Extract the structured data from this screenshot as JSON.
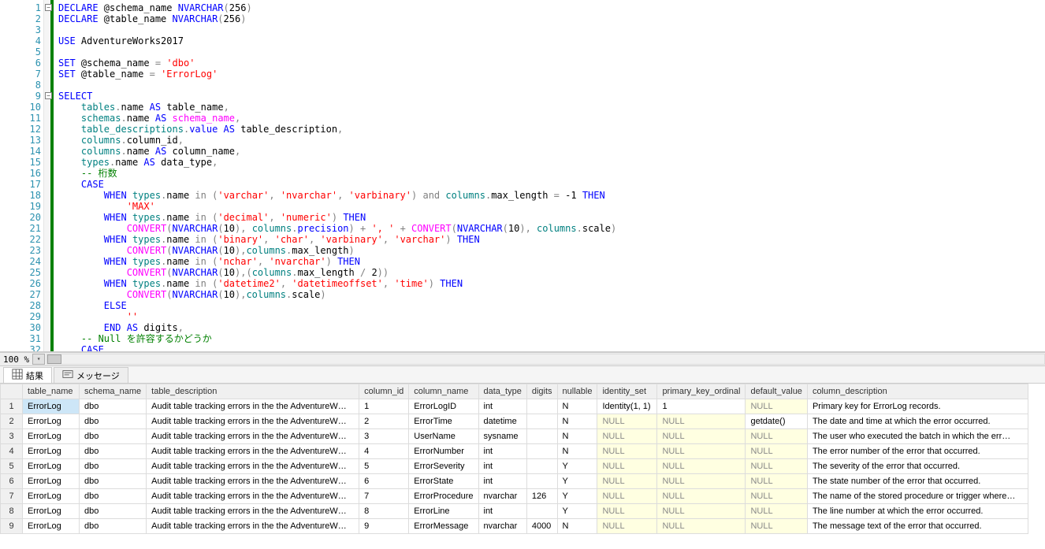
{
  "editor": {
    "lines": 32,
    "fold_markers": [
      {
        "line": 1,
        "sym": "−"
      },
      {
        "line": 9,
        "sym": "−"
      }
    ],
    "tokens": [
      [
        {
          "t": "DECLARE",
          "c": "kw"
        },
        {
          "t": " @schema_name ",
          "c": ""
        },
        {
          "t": "NVARCHAR",
          "c": "kw"
        },
        {
          "t": "(",
          "c": "op"
        },
        {
          "t": "256",
          "c": "num"
        },
        {
          "t": ")",
          "c": "op"
        }
      ],
      [
        {
          "t": "DECLARE",
          "c": "kw"
        },
        {
          "t": " @table_name ",
          "c": ""
        },
        {
          "t": "NVARCHAR",
          "c": "kw"
        },
        {
          "t": "(",
          "c": "op"
        },
        {
          "t": "256",
          "c": "num"
        },
        {
          "t": ")",
          "c": "op"
        }
      ],
      [],
      [
        {
          "t": "USE",
          "c": "kw"
        },
        {
          "t": " AdventureWorks2017",
          "c": ""
        }
      ],
      [],
      [
        {
          "t": "SET",
          "c": "kw"
        },
        {
          "t": " @schema_name ",
          "c": ""
        },
        {
          "t": "=",
          "c": "op"
        },
        {
          "t": " ",
          "c": ""
        },
        {
          "t": "'dbo'",
          "c": "str"
        }
      ],
      [
        {
          "t": "SET",
          "c": "kw"
        },
        {
          "t": " @table_name ",
          "c": ""
        },
        {
          "t": "=",
          "c": "op"
        },
        {
          "t": " ",
          "c": ""
        },
        {
          "t": "'ErrorLog'",
          "c": "str"
        }
      ],
      [],
      [
        {
          "t": "SELECT",
          "c": "kw"
        }
      ],
      [
        {
          "t": "    ",
          "c": ""
        },
        {
          "t": "tables",
          "c": "id"
        },
        {
          "t": ".",
          "c": "op"
        },
        {
          "t": "name",
          "c": ""
        },
        {
          "t": " AS ",
          "c": "kw"
        },
        {
          "t": "table_name",
          "c": ""
        },
        {
          "t": ",",
          "c": "op"
        }
      ],
      [
        {
          "t": "    ",
          "c": ""
        },
        {
          "t": "schemas",
          "c": "id"
        },
        {
          "t": ".",
          "c": "op"
        },
        {
          "t": "name",
          "c": ""
        },
        {
          "t": " AS ",
          "c": "kw"
        },
        {
          "t": "schema_name",
          "c": "fn"
        },
        {
          "t": ",",
          "c": "op"
        }
      ],
      [
        {
          "t": "    ",
          "c": ""
        },
        {
          "t": "table_descriptions",
          "c": "id"
        },
        {
          "t": ".",
          "c": "op"
        },
        {
          "t": "value",
          "c": "kw"
        },
        {
          "t": " AS ",
          "c": "kw"
        },
        {
          "t": "table_description",
          "c": ""
        },
        {
          "t": ",",
          "c": "op"
        }
      ],
      [
        {
          "t": "    ",
          "c": ""
        },
        {
          "t": "columns",
          "c": "id"
        },
        {
          "t": ".",
          "c": "op"
        },
        {
          "t": "column_id",
          "c": ""
        },
        {
          "t": ",",
          "c": "op"
        }
      ],
      [
        {
          "t": "    ",
          "c": ""
        },
        {
          "t": "columns",
          "c": "id"
        },
        {
          "t": ".",
          "c": "op"
        },
        {
          "t": "name",
          "c": ""
        },
        {
          "t": " AS ",
          "c": "kw"
        },
        {
          "t": "column_name",
          "c": ""
        },
        {
          "t": ",",
          "c": "op"
        }
      ],
      [
        {
          "t": "    ",
          "c": ""
        },
        {
          "t": "types",
          "c": "id"
        },
        {
          "t": ".",
          "c": "op"
        },
        {
          "t": "name",
          "c": ""
        },
        {
          "t": " AS ",
          "c": "kw"
        },
        {
          "t": "data_type",
          "c": ""
        },
        {
          "t": ",",
          "c": "op"
        }
      ],
      [
        {
          "t": "    ",
          "c": ""
        },
        {
          "t": "-- 桁数",
          "c": "cm"
        }
      ],
      [
        {
          "t": "    ",
          "c": ""
        },
        {
          "t": "CASE",
          "c": "kw"
        }
      ],
      [
        {
          "t": "        ",
          "c": ""
        },
        {
          "t": "WHEN",
          "c": "kw"
        },
        {
          "t": " ",
          "c": ""
        },
        {
          "t": "types",
          "c": "id"
        },
        {
          "t": ".",
          "c": "op"
        },
        {
          "t": "name",
          "c": ""
        },
        {
          "t": " in ",
          "c": "op"
        },
        {
          "t": "(",
          "c": "op"
        },
        {
          "t": "'varchar'",
          "c": "str"
        },
        {
          "t": ", ",
          "c": "op"
        },
        {
          "t": "'nvarchar'",
          "c": "str"
        },
        {
          "t": ", ",
          "c": "op"
        },
        {
          "t": "'varbinary'",
          "c": "str"
        },
        {
          "t": ")",
          "c": "op"
        },
        {
          "t": " and ",
          "c": "op"
        },
        {
          "t": "columns",
          "c": "id"
        },
        {
          "t": ".",
          "c": "op"
        },
        {
          "t": "max_length",
          "c": ""
        },
        {
          "t": " = ",
          "c": "op"
        },
        {
          "t": "-1 ",
          "c": "num"
        },
        {
          "t": "THEN",
          "c": "kw"
        }
      ],
      [
        {
          "t": "            ",
          "c": ""
        },
        {
          "t": "'MAX'",
          "c": "str"
        }
      ],
      [
        {
          "t": "        ",
          "c": ""
        },
        {
          "t": "WHEN",
          "c": "kw"
        },
        {
          "t": " ",
          "c": ""
        },
        {
          "t": "types",
          "c": "id"
        },
        {
          "t": ".",
          "c": "op"
        },
        {
          "t": "name",
          "c": ""
        },
        {
          "t": " in ",
          "c": "op"
        },
        {
          "t": "(",
          "c": "op"
        },
        {
          "t": "'decimal'",
          "c": "str"
        },
        {
          "t": ", ",
          "c": "op"
        },
        {
          "t": "'numeric'",
          "c": "str"
        },
        {
          "t": ")",
          "c": "op"
        },
        {
          "t": " THEN",
          "c": "kw"
        }
      ],
      [
        {
          "t": "            ",
          "c": ""
        },
        {
          "t": "CONVERT",
          "c": "fn"
        },
        {
          "t": "(",
          "c": "op"
        },
        {
          "t": "NVARCHAR",
          "c": "kw"
        },
        {
          "t": "(",
          "c": "op"
        },
        {
          "t": "10",
          "c": "num"
        },
        {
          "t": "), ",
          "c": "op"
        },
        {
          "t": "columns",
          "c": "id"
        },
        {
          "t": ".",
          "c": "op"
        },
        {
          "t": "precision",
          "c": "kw"
        },
        {
          "t": ")",
          "c": "op"
        },
        {
          "t": " + ",
          "c": "op"
        },
        {
          "t": "', '",
          "c": "str"
        },
        {
          "t": " + ",
          "c": "op"
        },
        {
          "t": "CONVERT",
          "c": "fn"
        },
        {
          "t": "(",
          "c": "op"
        },
        {
          "t": "NVARCHAR",
          "c": "kw"
        },
        {
          "t": "(",
          "c": "op"
        },
        {
          "t": "10",
          "c": "num"
        },
        {
          "t": "), ",
          "c": "op"
        },
        {
          "t": "columns",
          "c": "id"
        },
        {
          "t": ".",
          "c": "op"
        },
        {
          "t": "scale",
          "c": ""
        },
        {
          "t": ")",
          "c": "op"
        }
      ],
      [
        {
          "t": "        ",
          "c": ""
        },
        {
          "t": "WHEN",
          "c": "kw"
        },
        {
          "t": " ",
          "c": ""
        },
        {
          "t": "types",
          "c": "id"
        },
        {
          "t": ".",
          "c": "op"
        },
        {
          "t": "name",
          "c": ""
        },
        {
          "t": " in ",
          "c": "op"
        },
        {
          "t": "(",
          "c": "op"
        },
        {
          "t": "'binary'",
          "c": "str"
        },
        {
          "t": ", ",
          "c": "op"
        },
        {
          "t": "'char'",
          "c": "str"
        },
        {
          "t": ", ",
          "c": "op"
        },
        {
          "t": "'varbinary'",
          "c": "str"
        },
        {
          "t": ", ",
          "c": "op"
        },
        {
          "t": "'varchar'",
          "c": "str"
        },
        {
          "t": ")",
          "c": "op"
        },
        {
          "t": " THEN",
          "c": "kw"
        }
      ],
      [
        {
          "t": "            ",
          "c": ""
        },
        {
          "t": "CONVERT",
          "c": "fn"
        },
        {
          "t": "(",
          "c": "op"
        },
        {
          "t": "NVARCHAR",
          "c": "kw"
        },
        {
          "t": "(",
          "c": "op"
        },
        {
          "t": "10",
          "c": "num"
        },
        {
          "t": "),",
          "c": "op"
        },
        {
          "t": "columns",
          "c": "id"
        },
        {
          "t": ".",
          "c": "op"
        },
        {
          "t": "max_length",
          "c": ""
        },
        {
          "t": ")",
          "c": "op"
        }
      ],
      [
        {
          "t": "        ",
          "c": ""
        },
        {
          "t": "WHEN",
          "c": "kw"
        },
        {
          "t": " ",
          "c": ""
        },
        {
          "t": "types",
          "c": "id"
        },
        {
          "t": ".",
          "c": "op"
        },
        {
          "t": "name",
          "c": ""
        },
        {
          "t": " in ",
          "c": "op"
        },
        {
          "t": "(",
          "c": "op"
        },
        {
          "t": "'nchar'",
          "c": "str"
        },
        {
          "t": ", ",
          "c": "op"
        },
        {
          "t": "'nvarchar'",
          "c": "str"
        },
        {
          "t": ")",
          "c": "op"
        },
        {
          "t": " THEN",
          "c": "kw"
        }
      ],
      [
        {
          "t": "            ",
          "c": ""
        },
        {
          "t": "CONVERT",
          "c": "fn"
        },
        {
          "t": "(",
          "c": "op"
        },
        {
          "t": "NVARCHAR",
          "c": "kw"
        },
        {
          "t": "(",
          "c": "op"
        },
        {
          "t": "10",
          "c": "num"
        },
        {
          "t": "),(",
          "c": "op"
        },
        {
          "t": "columns",
          "c": "id"
        },
        {
          "t": ".",
          "c": "op"
        },
        {
          "t": "max_length",
          "c": ""
        },
        {
          "t": " / ",
          "c": "op"
        },
        {
          "t": "2",
          "c": "num"
        },
        {
          "t": "))",
          "c": "op"
        }
      ],
      [
        {
          "t": "        ",
          "c": ""
        },
        {
          "t": "WHEN",
          "c": "kw"
        },
        {
          "t": " ",
          "c": ""
        },
        {
          "t": "types",
          "c": "id"
        },
        {
          "t": ".",
          "c": "op"
        },
        {
          "t": "name",
          "c": ""
        },
        {
          "t": " in ",
          "c": "op"
        },
        {
          "t": "(",
          "c": "op"
        },
        {
          "t": "'datetime2'",
          "c": "str"
        },
        {
          "t": ", ",
          "c": "op"
        },
        {
          "t": "'datetimeoffset'",
          "c": "str"
        },
        {
          "t": ", ",
          "c": "op"
        },
        {
          "t": "'time'",
          "c": "str"
        },
        {
          "t": ")",
          "c": "op"
        },
        {
          "t": " THEN",
          "c": "kw"
        }
      ],
      [
        {
          "t": "            ",
          "c": ""
        },
        {
          "t": "CONVERT",
          "c": "fn"
        },
        {
          "t": "(",
          "c": "op"
        },
        {
          "t": "NVARCHAR",
          "c": "kw"
        },
        {
          "t": "(",
          "c": "op"
        },
        {
          "t": "10",
          "c": "num"
        },
        {
          "t": "),",
          "c": "op"
        },
        {
          "t": "columns",
          "c": "id"
        },
        {
          "t": ".",
          "c": "op"
        },
        {
          "t": "scale",
          "c": ""
        },
        {
          "t": ")",
          "c": "op"
        }
      ],
      [
        {
          "t": "        ",
          "c": ""
        },
        {
          "t": "ELSE",
          "c": "kw"
        }
      ],
      [
        {
          "t": "            ",
          "c": ""
        },
        {
          "t": "''",
          "c": "str"
        }
      ],
      [
        {
          "t": "        ",
          "c": ""
        },
        {
          "t": "END",
          "c": "kw"
        },
        {
          "t": " AS ",
          "c": "kw"
        },
        {
          "t": "digits",
          "c": ""
        },
        {
          "t": ",",
          "c": "op"
        }
      ],
      [
        {
          "t": "    ",
          "c": ""
        },
        {
          "t": "-- Null を許容するかどうか",
          "c": "cm"
        }
      ],
      [
        {
          "t": "    ",
          "c": ""
        },
        {
          "t": "CASE",
          "c": "kw"
        }
      ]
    ]
  },
  "zoom": {
    "pct": "100 %"
  },
  "tabs": {
    "results": "結果",
    "messages": "メッセージ"
  },
  "grid": {
    "headers": [
      "table_name",
      "schema_name",
      "table_description",
      "column_id",
      "column_name",
      "data_type",
      "digits",
      "nullable",
      "identity_set",
      "primary_key_ordinal",
      "default_value",
      "column_description"
    ],
    "widths": [
      72,
      80,
      270,
      60,
      85,
      60,
      36,
      48,
      76,
      112,
      76,
      280
    ],
    "null_text": "NULL",
    "rows": [
      {
        "n": 1,
        "c": [
          "ErrorLog",
          "dbo",
          "Audit table tracking errors in the the AdventureW…",
          "1",
          "ErrorLogID",
          "int",
          "",
          "N",
          "Identity(1, 1)",
          "1",
          null,
          "Primary key for ErrorLog records."
        ]
      },
      {
        "n": 2,
        "c": [
          "ErrorLog",
          "dbo",
          "Audit table tracking errors in the the AdventureW…",
          "2",
          "ErrorTime",
          "datetime",
          "",
          "N",
          null,
          null,
          "getdate()",
          "The date and time at which the error occurred."
        ]
      },
      {
        "n": 3,
        "c": [
          "ErrorLog",
          "dbo",
          "Audit table tracking errors in the the AdventureW…",
          "3",
          "UserName",
          "sysname",
          "",
          "N",
          null,
          null,
          null,
          "The user who executed the batch in which the err…"
        ]
      },
      {
        "n": 4,
        "c": [
          "ErrorLog",
          "dbo",
          "Audit table tracking errors in the the AdventureW…",
          "4",
          "ErrorNumber",
          "int",
          "",
          "N",
          null,
          null,
          null,
          "The error number of the error that occurred."
        ]
      },
      {
        "n": 5,
        "c": [
          "ErrorLog",
          "dbo",
          "Audit table tracking errors in the the AdventureW…",
          "5",
          "ErrorSeverity",
          "int",
          "",
          "Y",
          null,
          null,
          null,
          "The severity of the error that occurred."
        ]
      },
      {
        "n": 6,
        "c": [
          "ErrorLog",
          "dbo",
          "Audit table tracking errors in the the AdventureW…",
          "6",
          "ErrorState",
          "int",
          "",
          "Y",
          null,
          null,
          null,
          "The state number of the error that occurred."
        ]
      },
      {
        "n": 7,
        "c": [
          "ErrorLog",
          "dbo",
          "Audit table tracking errors in the the AdventureW…",
          "7",
          "ErrorProcedure",
          "nvarchar",
          "126",
          "Y",
          null,
          null,
          null,
          "The name of the stored procedure or trigger where…"
        ]
      },
      {
        "n": 8,
        "c": [
          "ErrorLog",
          "dbo",
          "Audit table tracking errors in the the AdventureW…",
          "8",
          "ErrorLine",
          "int",
          "",
          "Y",
          null,
          null,
          null,
          "The line number at which the error occurred."
        ]
      },
      {
        "n": 9,
        "c": [
          "ErrorLog",
          "dbo",
          "Audit table tracking errors in the the AdventureW…",
          "9",
          "ErrorMessage",
          "nvarchar",
          "4000",
          "N",
          null,
          null,
          null,
          "The message text of the error that occurred."
        ]
      }
    ]
  }
}
